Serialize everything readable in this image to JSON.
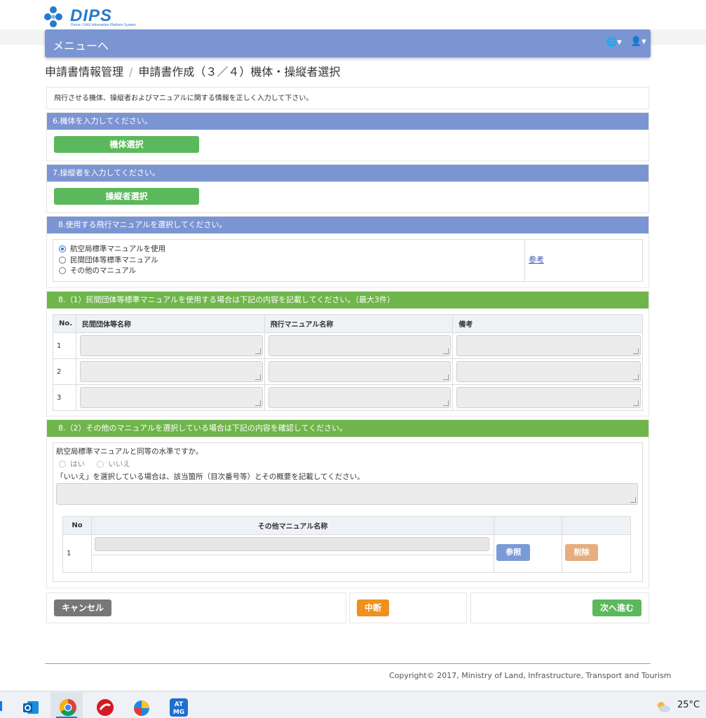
{
  "brand": {
    "name": "DIPS",
    "sub": "Drone / UAS Information Platform System"
  },
  "topbar": {
    "menu_label": "メニューへ",
    "globe_label": "🌐▾",
    "user_label": "👤▾"
  },
  "breadcrumb": {
    "root": "申請書情報管理",
    "separator": "/",
    "current": "申請書作成（３／４）機体・操縦者選択"
  },
  "intro": "飛行させる機体、操縦者およびマニュアルに関する情報を正しく入力して下さい。",
  "aircraft": {
    "heading": "6.機体を入力してください。",
    "button": "機体選択"
  },
  "operator": {
    "heading": "7.操縦者を入力してください。",
    "button": "操縦者選択"
  },
  "manual": {
    "heading": "8.使用する飛行マニュアルを選択してください。",
    "options": [
      "航空局標準マニュアルを使用",
      "民間団体等標準マニュアル",
      "その他のマニュアル"
    ],
    "selected_index": 0,
    "reference_link": "参考"
  },
  "org_manual": {
    "heading": "8.（1）民間団体等標準マニュアルを使用する場合は下記の内容を記載してください。（最大3件）",
    "columns": [
      "No.",
      "民間団体等名称",
      "飛行マニュアル名称",
      "備考"
    ],
    "rows": [
      "1",
      "2",
      "3"
    ]
  },
  "other_manual": {
    "heading": "8.（2）その他のマニュアルを選択している場合は下記の内容を確認してください。",
    "question": "航空局標準マニュアルと同等の水準ですか。",
    "answers": [
      "はい",
      "いいえ"
    ],
    "note": "「いいえ」を選択している場合は、該当箇所（目次番号等）とその概要を記載してください。",
    "columns": [
      "No",
      "その他マニュアル名称"
    ],
    "row_no": "1",
    "browse_button": "参照",
    "delete_button": "削除"
  },
  "actions": {
    "cancel": "キャンセル",
    "suspend": "中断",
    "next": "次へ進む"
  },
  "footer": {
    "copyright": "Copyright© 2017, Ministry of Land, Infrastructure, Transport and Tourism"
  },
  "taskbar": {
    "temperature": "25°C"
  },
  "colors": {
    "nav": "#7b95d3",
    "section_green": "#6fb54b",
    "button_green": "#5cb85c",
    "cancel": "#777777",
    "suspend": "#f0901e",
    "browse": "#7b9ad8",
    "delete": "#e6ad7d"
  }
}
